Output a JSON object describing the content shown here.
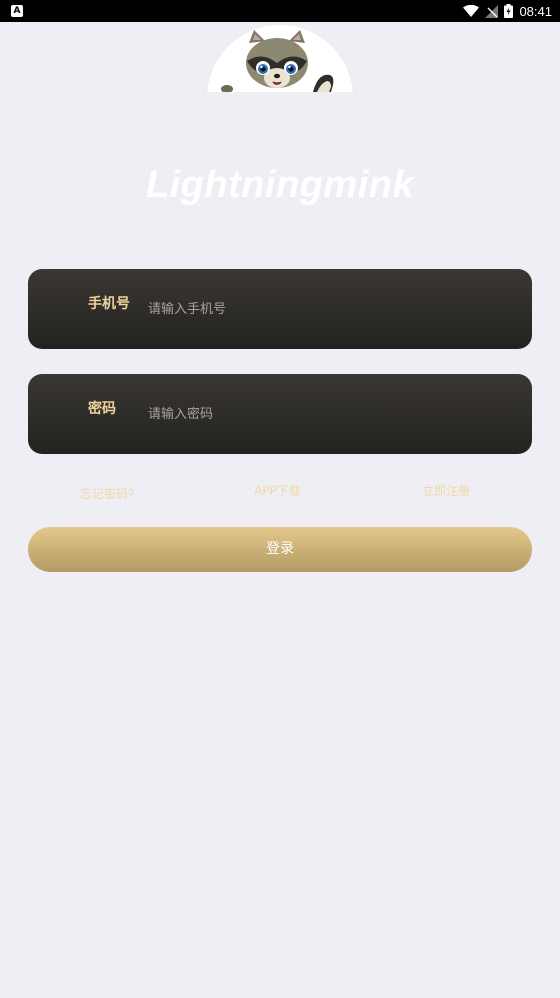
{
  "status_bar": {
    "left_badge": "A",
    "time": "08:41"
  },
  "app": {
    "title": "Lightningmink"
  },
  "form": {
    "phone": {
      "label": "手机号",
      "placeholder": "请输入手机号"
    },
    "password": {
      "label": "密码",
      "placeholder": "请输入密码"
    }
  },
  "links": {
    "forgot": "忘记密码?",
    "app_download": "APP下载",
    "register": "立即注册"
  },
  "login_button": "登录",
  "colors": {
    "background": "#efeef4",
    "field_bg": "#2b2925",
    "label_gold": "#eed39a",
    "button_gold": "#d1b67c"
  }
}
